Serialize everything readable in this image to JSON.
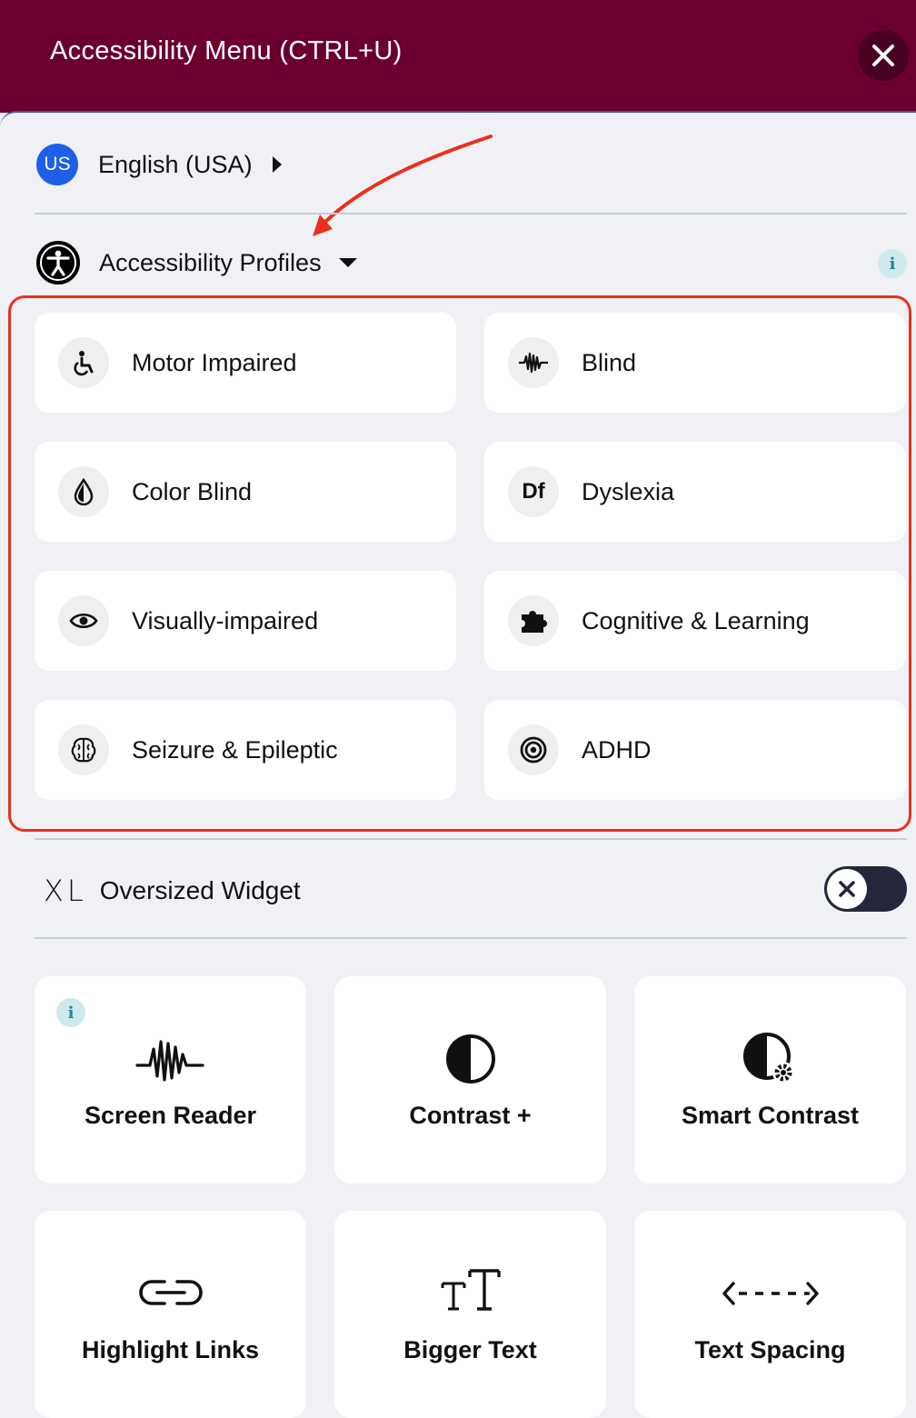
{
  "header": {
    "title": "Accessibility Menu (CTRL+U)"
  },
  "language": {
    "flag_code": "US",
    "label": "English (USA)"
  },
  "profiles": {
    "title": "Accessibility Profiles",
    "info": "i",
    "items": [
      {
        "label": "Motor Impaired",
        "icon": "wheelchair-icon"
      },
      {
        "label": "Blind",
        "icon": "sound-wave-icon"
      },
      {
        "label": "Color Blind",
        "icon": "droplet-icon"
      },
      {
        "label": "Dyslexia",
        "icon": "df-icon",
        "icon_text": "Df"
      },
      {
        "label": "Visually-impaired",
        "icon": "eye-icon"
      },
      {
        "label": "Cognitive & Learning",
        "icon": "puzzle-icon"
      },
      {
        "label": "Seizure & Epileptic",
        "icon": "brain-icon"
      },
      {
        "label": "ADHD",
        "icon": "target-icon"
      }
    ]
  },
  "oversized": {
    "icon_text": "XL",
    "label": "Oversized Widget",
    "enabled": false
  },
  "tools": {
    "info": "i",
    "items": [
      {
        "label": "Screen Reader",
        "icon": "sound-wave-icon"
      },
      {
        "label": "Contrast +",
        "icon": "contrast-icon"
      },
      {
        "label": "Smart Contrast",
        "icon": "smart-contrast-icon"
      },
      {
        "label": "Highlight Links",
        "icon": "link-icon"
      },
      {
        "label": "Bigger Text",
        "icon": "text-size-icon",
        "icon_text": "TT"
      },
      {
        "label": "Text Spacing",
        "icon": "spacing-arrows-icon",
        "icon_text": "<--->"
      }
    ]
  },
  "colors": {
    "header_bg": "#6b0030",
    "highlight": "#e9301c",
    "flag": "#1f5fe8"
  }
}
